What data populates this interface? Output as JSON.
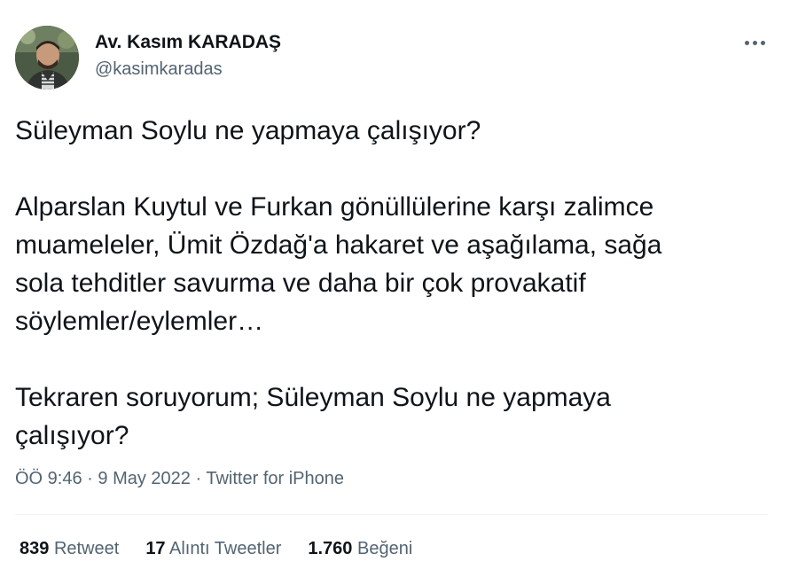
{
  "author": {
    "name": "Av. Kasım KARADAŞ",
    "handle": "@kasimkaradas"
  },
  "tweet": {
    "paragraphs": [
      "Süleyman Soylu ne yapmaya çalışıyor?",
      "Alparslan Kuytul ve Furkan gönüllülerine karşı zalimce\nmuameleler, Ümit Özdağ'a hakaret ve aşağılama, sağa\nsola tehditler savurma ve daha bir çok provakatif\nsöylemler/eylemler…",
      "Tekraren soruyorum; Süleyman Soylu ne yapmaya\nçalışıyor?"
    ],
    "time": "ÖÖ 9:46",
    "date": "9 May 2022",
    "source": "Twitter for iPhone",
    "separator": "·"
  },
  "stats": {
    "retweets_count": "839",
    "retweets_label": "Retweet",
    "quotes_count": "17",
    "quotes_label": "Alıntı Tweetler",
    "likes_count": "1.760",
    "likes_label": "Beğeni"
  },
  "icons": {
    "more": "more-horizontal-icon"
  },
  "colors": {
    "text_primary": "#0f1419",
    "text_secondary": "#536471",
    "divider": "#eff3f4"
  }
}
